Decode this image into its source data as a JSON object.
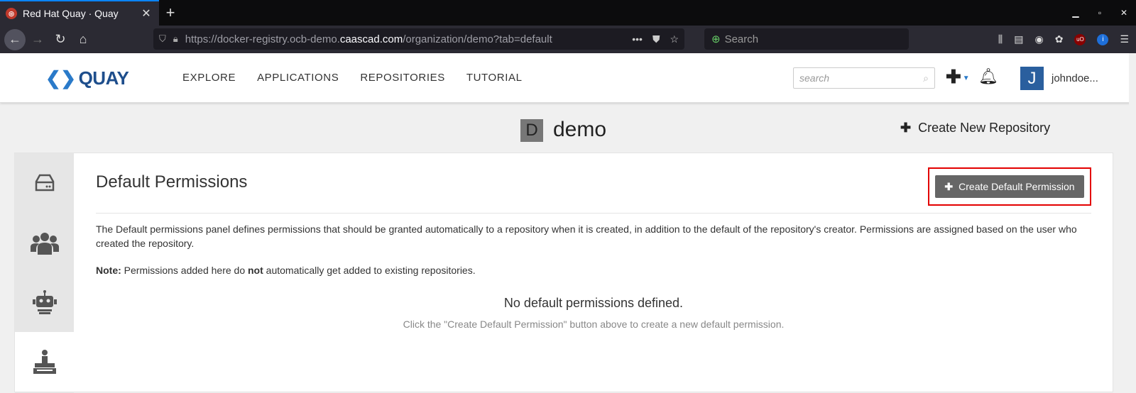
{
  "browser": {
    "tab_title": "Red Hat Quay · Quay",
    "url_prefix": "https://docker-registry.ocb-demo.",
    "url_domain": "caascad.com",
    "url_suffix": "/organization/demo?tab=default",
    "search_placeholder": "Search"
  },
  "header": {
    "logo_text": "QUAY",
    "nav": [
      "EXPLORE",
      "APPLICATIONS",
      "REPOSITORIES",
      "TUTORIAL"
    ],
    "search_placeholder": "search",
    "avatar_letter": "J",
    "username": "johndoe..."
  },
  "org": {
    "badge_letter": "D",
    "name": "demo",
    "create_repo_label": "Create New Repository"
  },
  "panel": {
    "title": "Default Permissions",
    "create_button_label": "Create Default Permission",
    "description": "The Default permissions panel defines permissions that should be granted automatically to a repository when it is created, in addition to the default of the repository's creator. Permissions are assigned based on the user who created the repository.",
    "note_label": "Note:",
    "note_pre": "Permissions added here do",
    "note_bold": "not",
    "note_post": "automatically get added to existing repositories.",
    "empty_title": "No default permissions defined.",
    "empty_hint": "Click the \"Create Default Permission\" button above to create a new default permission."
  },
  "sidebar": {
    "items": [
      "repositories-icon",
      "teams-icon",
      "robots-icon",
      "default-permissions-icon"
    ],
    "active_index": 3
  },
  "colors": {
    "highlight": "#e30000",
    "brand": "#1e4e8c",
    "button": "#666666"
  }
}
